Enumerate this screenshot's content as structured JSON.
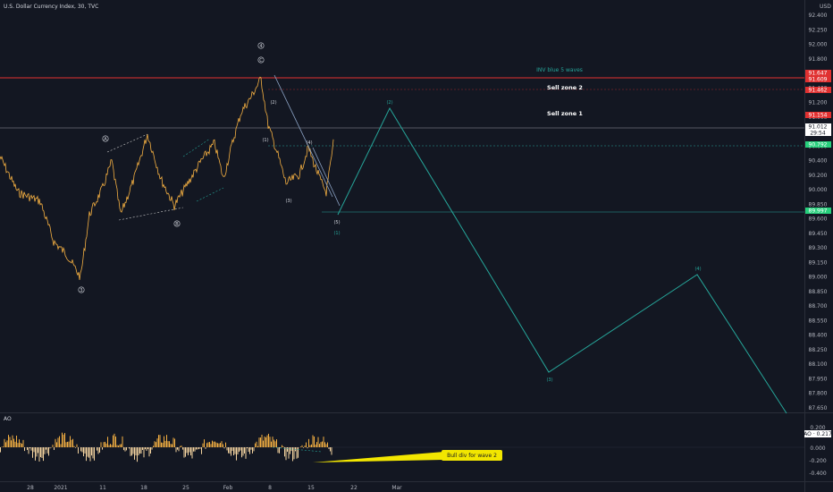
{
  "header": {
    "title": "U.S. Dollar Currency Index, 30, TVC",
    "currency": "USD"
  },
  "annotations": {
    "inv_blue": "INV blue 5 waves",
    "sell_zone_2": "Sell zone 2",
    "sell_zone_1": "Sell zone 1",
    "bull_div": "Bull div for wave 2"
  },
  "indicator": {
    "name": "AO",
    "value_badge": "AO · 0.217"
  },
  "wave_labels": {
    "c4": "4",
    "cC": "C",
    "cA": "A",
    "cB": "B",
    "c3": "3",
    "p1": "(1)",
    "p2": "(2)",
    "p3": "(3)",
    "p4": "(4)",
    "p5": "(5)",
    "proj_p2": "(2)",
    "proj_p3": "(3)",
    "proj_p4": "(4)",
    "proj_p1": "(1)"
  },
  "price_axis": {
    "ticks": [
      "92.400",
      "92.250",
      "92.000",
      "91.800",
      "91.600",
      "91.400",
      "91.200",
      "91.000",
      "90.800",
      "90.600",
      "90.400",
      "90.200",
      "90.000",
      "89.850",
      "89.600",
      "89.450",
      "89.300",
      "89.150",
      "89.000",
      "88.850",
      "88.700",
      "88.550",
      "88.400",
      "88.250",
      "88.100",
      "87.950",
      "87.800",
      "87.650"
    ],
    "badges": [
      {
        "text": "91.647",
        "color": "#e03030"
      },
      {
        "text": "91.609",
        "color": "#e03030"
      },
      {
        "text": "91.462",
        "color": "#e03030"
      },
      {
        "text": "91.154",
        "color": "#e03030"
      },
      {
        "text": "91.012",
        "color": "#ffffff"
      },
      {
        "text": "29:54",
        "color": "#ffffff"
      },
      {
        "text": "90.792",
        "color": "#26d07c"
      },
      {
        "text": "89.997",
        "color": "#26d07c"
      }
    ]
  },
  "ao_axis": {
    "ticks": [
      "0.200",
      "0.000",
      "-0.200",
      "-0.400"
    ]
  },
  "time_axis": {
    "ticks": [
      "28",
      "2021",
      "11",
      "18",
      "25",
      "Feb",
      "8",
      "15",
      "22",
      "Mar"
    ]
  },
  "colors": {
    "background": "#131722",
    "price": "#f5b042",
    "projection": "#26a69a",
    "red_line": "#e03030",
    "accent_yellow": "#f2e600"
  }
}
